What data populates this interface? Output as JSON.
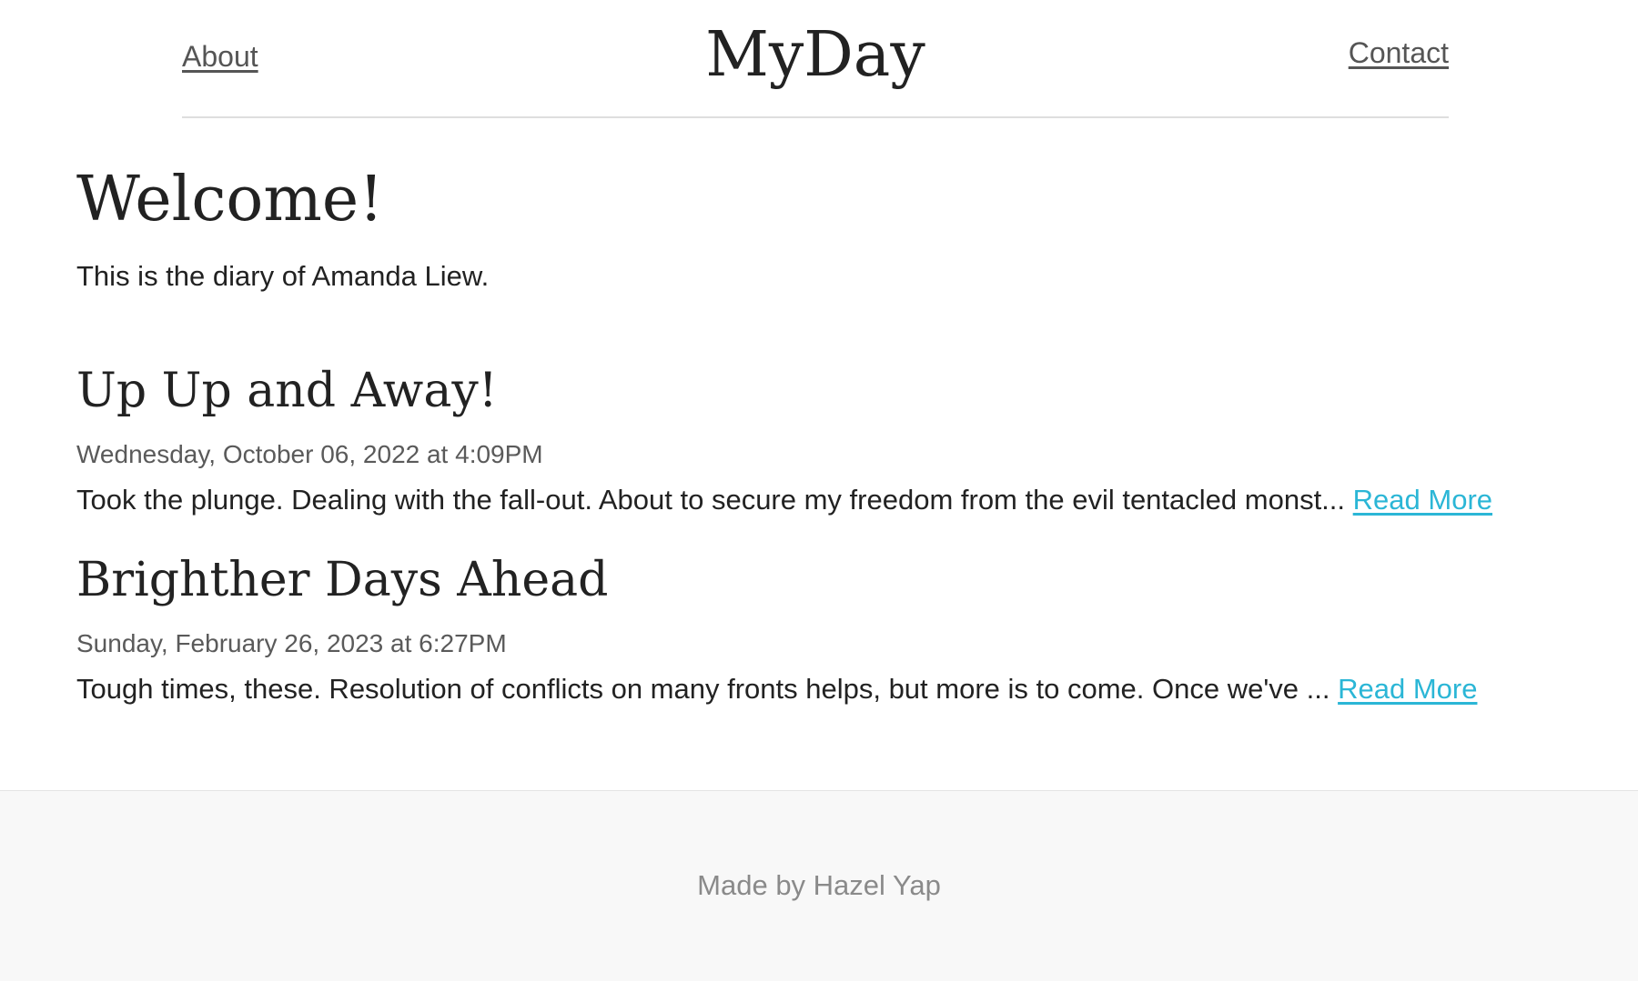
{
  "header": {
    "about_label": "About",
    "site_title": "MyDay",
    "contact_label": "Contact"
  },
  "welcome": {
    "title": "Welcome!",
    "intro": "This is the diary of Amanda Liew."
  },
  "posts": [
    {
      "title": "Up Up and Away!",
      "date": "Wednesday, October 06, 2022 at 4:09PM",
      "excerpt": "Took the plunge. Dealing with the fall-out. About to secure my freedom from the evil tentacled monst...",
      "read_more_label": "Read More"
    },
    {
      "title": "Brighther Days Ahead",
      "date": "Sunday, February 26, 2023 at 6:27PM",
      "excerpt": "Tough times, these. Resolution of conflicts on many fronts helps, but more is to come. Once we've ...",
      "read_more_label": "Read More"
    }
  ],
  "footer": {
    "credit": "Made by Hazel Yap"
  },
  "colors": {
    "link_accent": "#2bb6d6",
    "text_primary": "#222222",
    "text_muted": "#5a5a5a",
    "footer_bg": "#f8f8f8"
  }
}
